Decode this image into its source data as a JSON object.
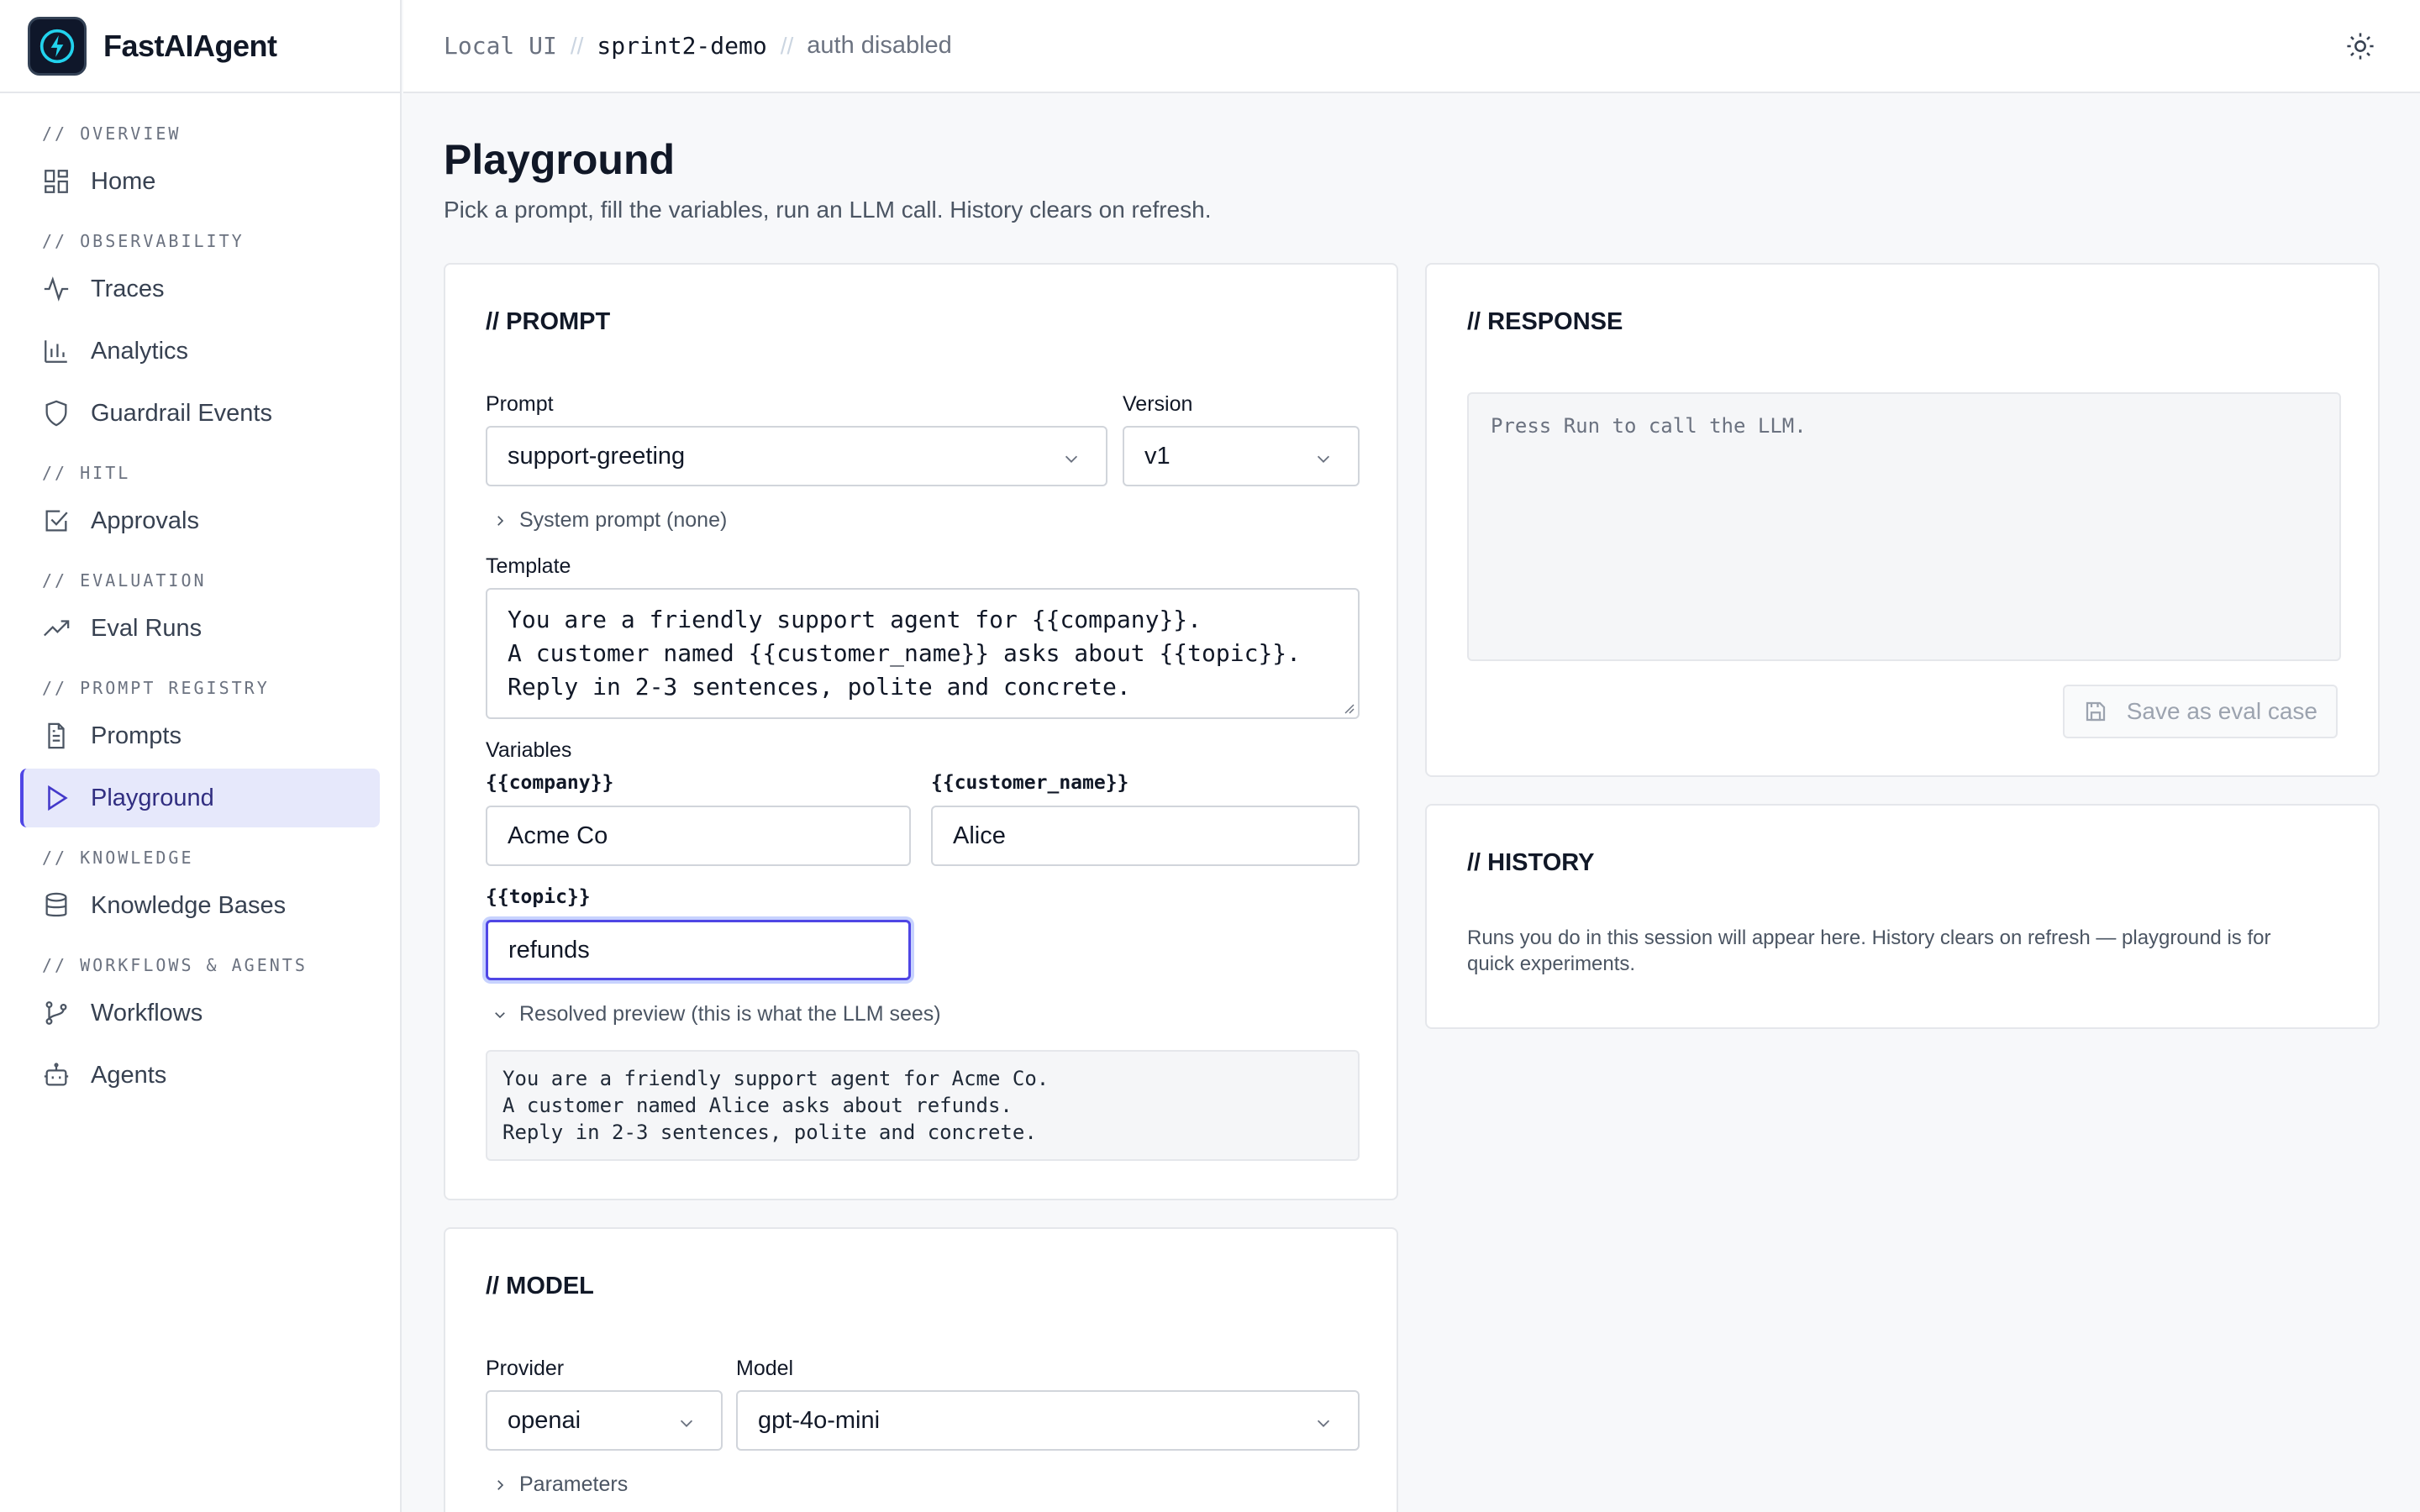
{
  "brand": {
    "name": "FastAIAgent",
    "logo_icon": "bolt-icon"
  },
  "topbar": {
    "crumbs": [
      "Local UI",
      "sprint2-demo",
      "auth disabled"
    ],
    "separator": "//",
    "theme_icon": "sun-icon"
  },
  "sidebar": {
    "sections": [
      {
        "label": "// OVERVIEW",
        "items": [
          {
            "label": "Home",
            "icon": "grid-icon"
          }
        ]
      },
      {
        "label": "// OBSERVABILITY",
        "items": [
          {
            "label": "Traces",
            "icon": "activity-icon"
          },
          {
            "label": "Analytics",
            "icon": "bar-chart-icon"
          },
          {
            "label": "Guardrail Events",
            "icon": "shield-icon"
          }
        ]
      },
      {
        "label": "// HITL",
        "items": [
          {
            "label": "Approvals",
            "icon": "check-square-icon"
          }
        ]
      },
      {
        "label": "// EVALUATION",
        "items": [
          {
            "label": "Eval Runs",
            "icon": "trending-up-icon"
          }
        ]
      },
      {
        "label": "// PROMPT REGISTRY",
        "items": [
          {
            "label": "Prompts",
            "icon": "file-text-icon"
          },
          {
            "label": "Playground",
            "icon": "play-icon",
            "active": true
          }
        ]
      },
      {
        "label": "// KNOWLEDGE",
        "items": [
          {
            "label": "Knowledge Bases",
            "icon": "database-icon"
          }
        ]
      },
      {
        "label": "// WORKFLOWS & AGENTS",
        "items": [
          {
            "label": "Workflows",
            "icon": "git-branch-icon"
          },
          {
            "label": "Agents",
            "icon": "bot-icon"
          }
        ]
      }
    ],
    "accent_color": "#4f46e5",
    "active_bg": "#e6e8fb"
  },
  "page": {
    "title": "Playground",
    "subtitle": "Pick a prompt, fill the variables, run an LLM call. History clears on refresh."
  },
  "prompt_card": {
    "title": "// PROMPT",
    "prompt_label": "Prompt",
    "prompt_value": "support-greeting",
    "version_label": "Version",
    "version_value": "v1",
    "system_prompt_toggle": "System prompt (none)",
    "template_label": "Template",
    "template_value": "You are a friendly support agent for {{company}}.\nA customer named {{customer_name}} asks about {{topic}}.\nReply in 2-3 sentences, polite and concrete.",
    "variables_label": "Variables",
    "variables": [
      {
        "name": "{{company}}",
        "value": "Acme Co"
      },
      {
        "name": "{{customer_name}}",
        "value": "Alice"
      },
      {
        "name": "{{topic}}",
        "value": "refunds"
      }
    ],
    "preview_toggle": "Resolved preview (this is what the LLM sees)",
    "preview_text": "You are a friendly support agent for Acme Co.\nA customer named Alice asks about refunds.\nReply in 2-3 sentences, polite and concrete."
  },
  "model_card": {
    "title": "// MODEL",
    "provider_label": "Provider",
    "provider_value": "openai",
    "model_label": "Model",
    "model_value": "gpt-4o-mini",
    "parameters_toggle": "Parameters"
  },
  "response_card": {
    "title": "// RESPONSE",
    "placeholder": "Press Run to call the LLM.",
    "save_button": "Save as eval case",
    "save_icon": "save-icon"
  },
  "history_card": {
    "title": "// HISTORY",
    "empty_text": "Runs you do in this session will appear here. History clears on refresh — playground is for quick experiments."
  }
}
